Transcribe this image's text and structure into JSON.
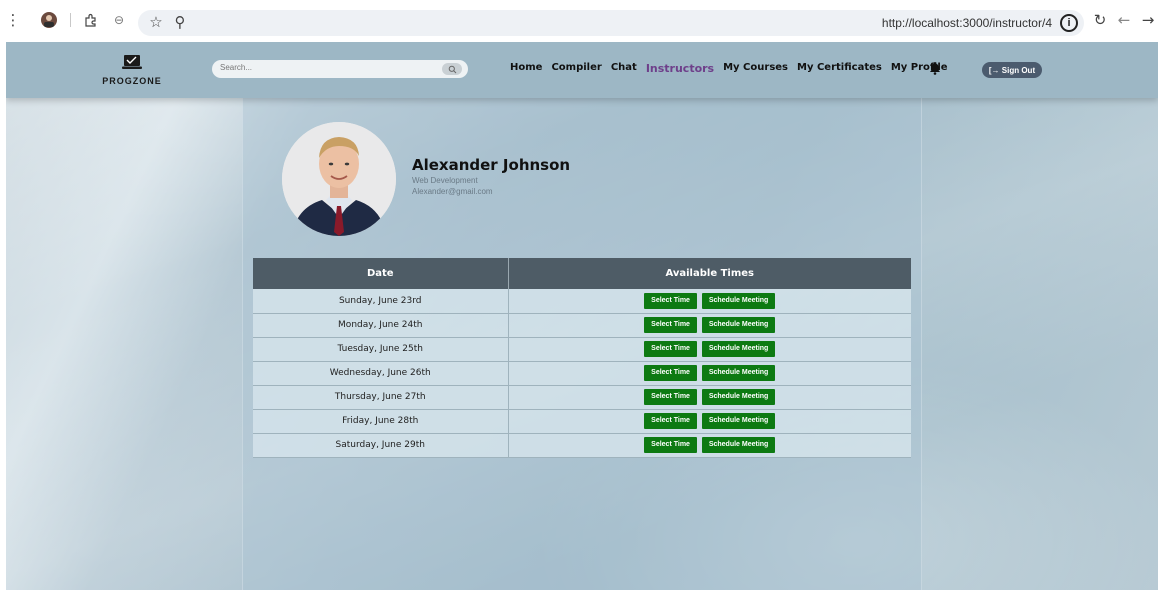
{
  "browser": {
    "url": "http://localhost:3000/instructor/4",
    "icons": [
      "menu-dots-icon",
      "profile-avatar-icon",
      "extensions-icon",
      "tracking-icon",
      "bookmark-star-icon",
      "zoom-icon",
      "site-info-icon",
      "reload-icon",
      "back-icon",
      "forward-icon"
    ]
  },
  "header": {
    "logo_text": "PROGZONE",
    "search_placeholder": "Search...",
    "nav": [
      "Home",
      "Compiler",
      "Chat",
      "Instructors",
      "My Courses",
      "My Certificates",
      "My Profile"
    ],
    "active_nav": "Instructors",
    "signout_label": "[→ Sign Out"
  },
  "instructor": {
    "name": "Alexander Johnson",
    "specialty": "Web Development",
    "email": "Alexander@gmail.com"
  },
  "schedule": {
    "headers": [
      "Date",
      "Available Times"
    ],
    "select_label": "Select Time",
    "meeting_label": "Schedule Meeting",
    "rows": [
      "Sunday, June 23rd",
      "Monday, June 24th",
      "Tuesday, June 25th",
      "Wednesday, June 26th",
      "Thursday, June 27th",
      "Friday, June 28th",
      "Saturday, June 29th"
    ]
  },
  "colors": {
    "action_green": "#0d7a12",
    "table_header": "#4e5c66",
    "active_nav": "#6e3f8a",
    "navbar": "#9db7c5"
  }
}
